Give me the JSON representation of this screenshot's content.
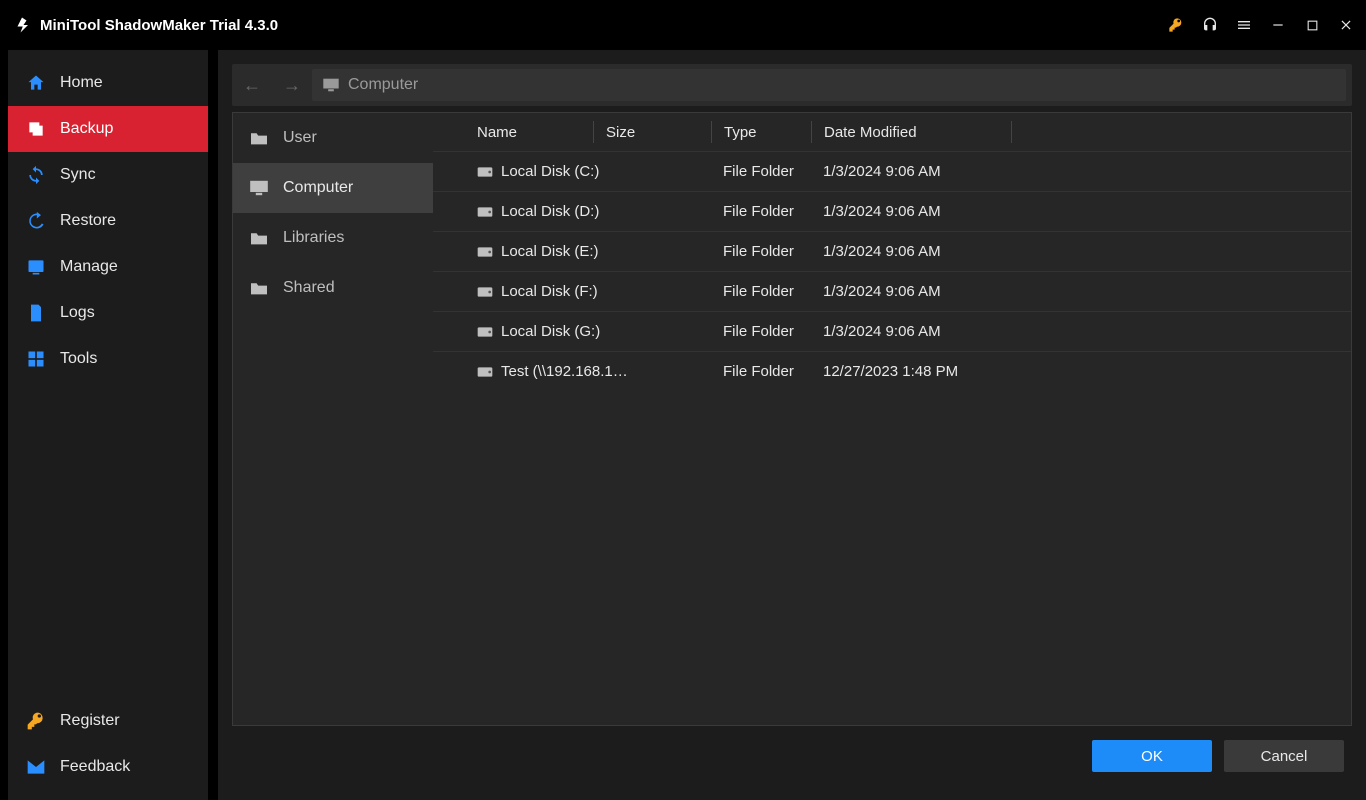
{
  "titlebar": {
    "title": "MiniTool ShadowMaker Trial 4.3.0"
  },
  "sidebar": {
    "items": [
      {
        "label": "Home"
      },
      {
        "label": "Backup"
      },
      {
        "label": "Sync"
      },
      {
        "label": "Restore"
      },
      {
        "label": "Manage"
      },
      {
        "label": "Logs"
      },
      {
        "label": "Tools"
      }
    ],
    "register": "Register",
    "feedback": "Feedback"
  },
  "pathbar": {
    "location": "Computer"
  },
  "places": {
    "items": [
      {
        "label": "User"
      },
      {
        "label": "Computer"
      },
      {
        "label": "Libraries"
      },
      {
        "label": "Shared"
      }
    ]
  },
  "columns": {
    "name": "Name",
    "size": "Size",
    "type": "Type",
    "date": "Date Modified"
  },
  "rows": [
    {
      "name": "Local Disk (C:)",
      "type": "File Folder",
      "date": "1/3/2024 9:06 AM"
    },
    {
      "name": "Local Disk (D:)",
      "type": "File Folder",
      "date": "1/3/2024 9:06 AM"
    },
    {
      "name": "Local Disk (E:)",
      "type": "File Folder",
      "date": "1/3/2024 9:06 AM"
    },
    {
      "name": "Local Disk (F:)",
      "type": "File Folder",
      "date": "1/3/2024 9:06 AM"
    },
    {
      "name": "Local Disk (G:)",
      "type": "File Folder",
      "date": "1/3/2024 9:06 AM"
    },
    {
      "name": "Test (\\\\192.168.1…",
      "type": "File Folder",
      "date": "12/27/2023 1:48 PM"
    }
  ],
  "buttons": {
    "ok": "OK",
    "cancel": "Cancel"
  }
}
